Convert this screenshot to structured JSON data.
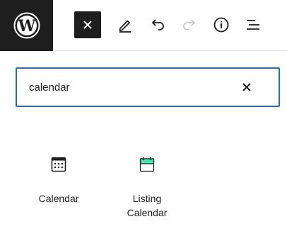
{
  "toolbar": {
    "logo": "wordpress-logo",
    "buttons": [
      {
        "icon": "close-icon",
        "state": "active"
      },
      {
        "icon": "pencil-icon"
      },
      {
        "icon": "undo-icon"
      },
      {
        "icon": "redo-icon",
        "state": "disabled"
      },
      {
        "icon": "info-icon"
      },
      {
        "icon": "list-view-icon"
      }
    ]
  },
  "search": {
    "value": "calendar",
    "clear_icon": "close-icon",
    "border_color": "#2271b1"
  },
  "results": [
    {
      "label": "Calendar",
      "icon": "calendar-icon"
    },
    {
      "label_line1": "Listing",
      "label_line2": "Calendar",
      "icon": "listing-calendar-icon",
      "accent": "#45e8b0"
    }
  ]
}
